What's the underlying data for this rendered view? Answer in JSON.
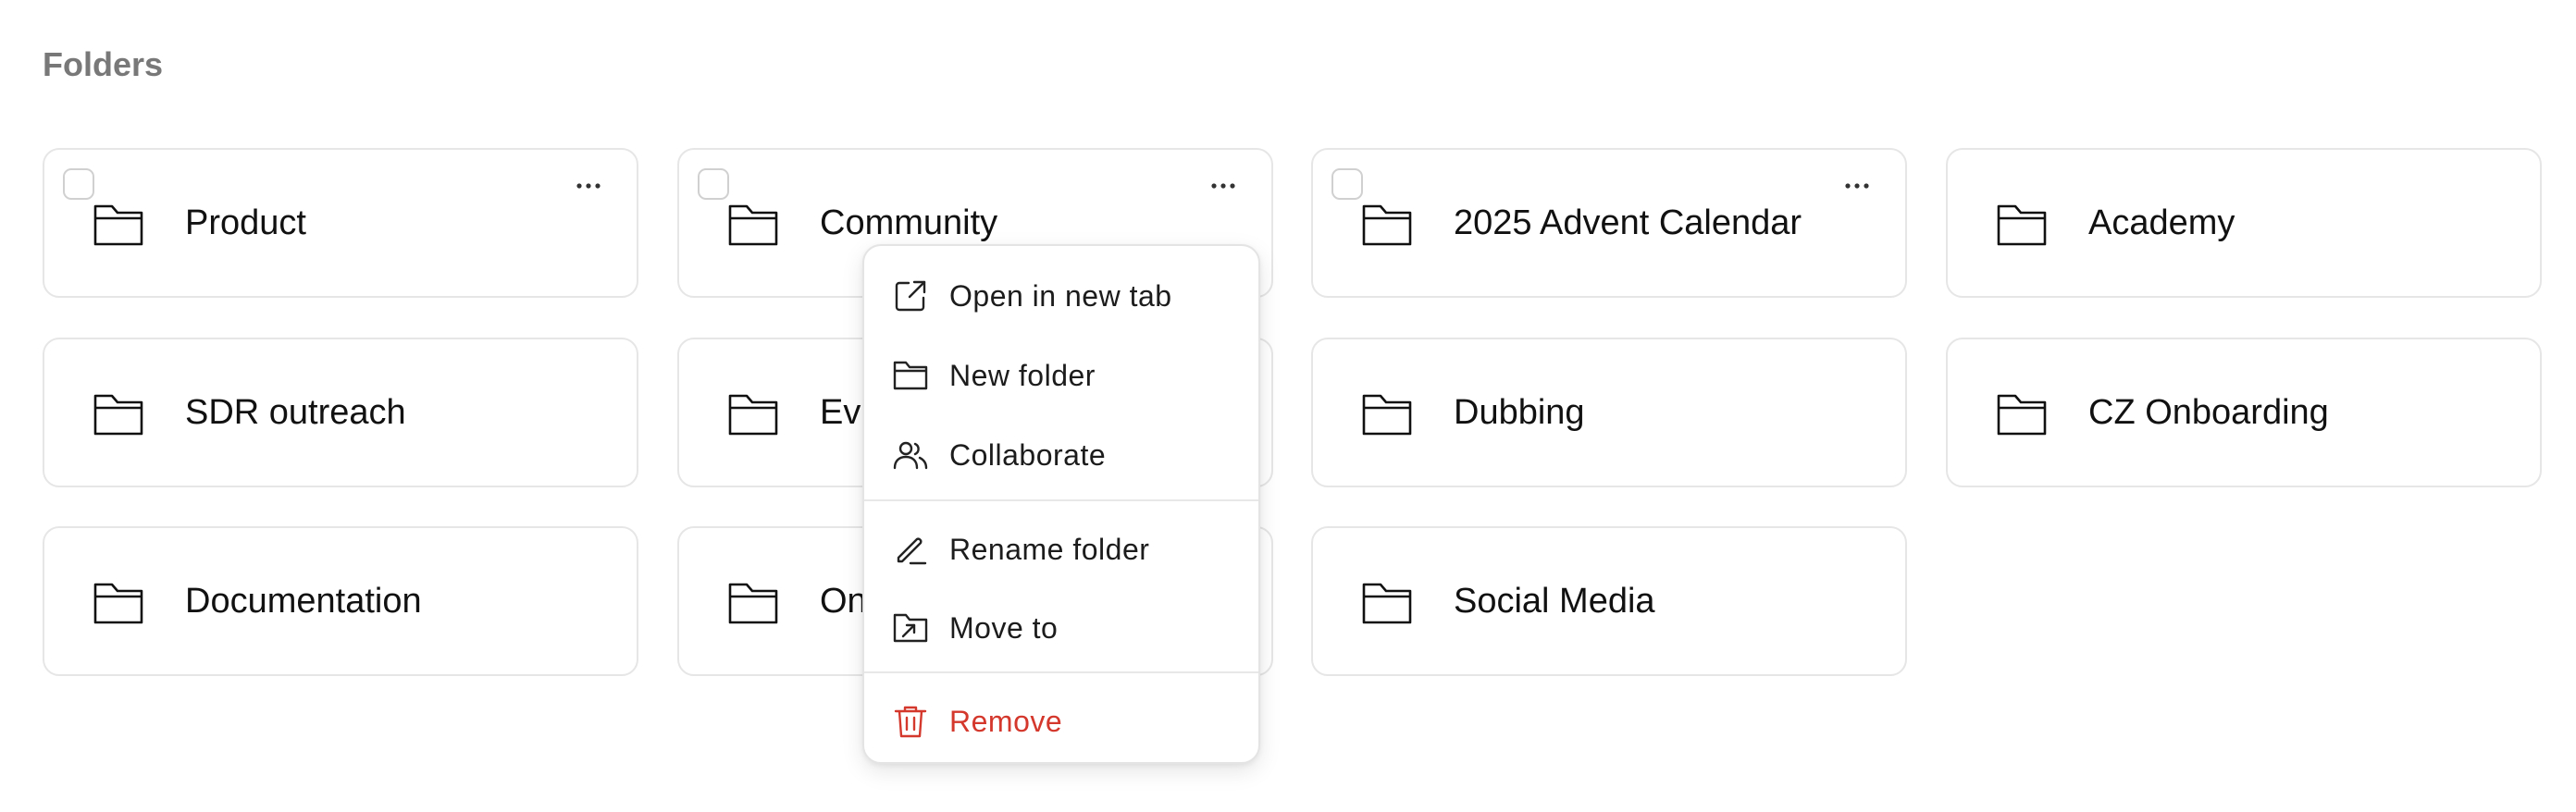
{
  "section": {
    "title": "Folders"
  },
  "folders": [
    {
      "label": "Product"
    },
    {
      "label": "Community"
    },
    {
      "label": "2025 Advent Calendar"
    },
    {
      "label": "Academy"
    },
    {
      "label": "SDR outreach"
    },
    {
      "label": "Events"
    },
    {
      "label": "Dubbing"
    },
    {
      "label": "CZ Onboarding"
    },
    {
      "label": "Documentation"
    },
    {
      "label": "Onboarding"
    },
    {
      "label": "Social Media"
    }
  ],
  "context_menu": {
    "items": [
      {
        "label": "Open in new tab",
        "icon": "external-link-icon"
      },
      {
        "label": "New folder",
        "icon": "folder-icon"
      },
      {
        "label": "Collaborate",
        "icon": "users-icon"
      },
      {
        "label": "Rename folder",
        "icon": "pencil-icon"
      },
      {
        "label": "Move to",
        "icon": "folder-move-icon"
      },
      {
        "label": "Remove",
        "icon": "trash-icon"
      }
    ]
  },
  "colors": {
    "danger": "#d4372c",
    "heading": "#787878",
    "border": "#e6e6e6"
  }
}
